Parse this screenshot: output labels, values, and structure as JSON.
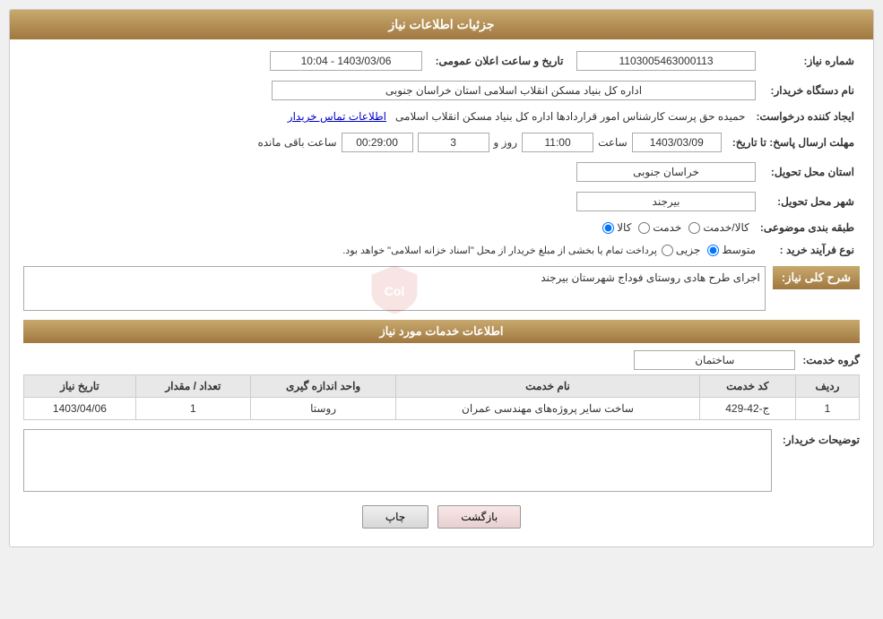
{
  "header": {
    "title": "جزئیات اطلاعات نیاز"
  },
  "fields": {
    "need_number_label": "شماره نیاز:",
    "need_number_value": "1103005463000113",
    "announce_label": "تاریخ و ساعت اعلان عمومی:",
    "announce_value": "1403/03/06 - 10:04",
    "buyer_name_label": "نام دستگاه خریدار:",
    "buyer_name_value": "اداره کل بنیاد مسکن انقلاب اسلامی استان خراسان جنوبی",
    "creator_label": "ایجاد کننده درخواست:",
    "creator_value": "حمیده حق پرست کارشناس امور قراردادها اداره کل بنیاد مسکن انقلاب اسلامی",
    "creator_link": "اطلاعات تماس خریدار",
    "deadline_label": "مهلت ارسال پاسخ: تا تاریخ:",
    "deadline_date": "1403/03/09",
    "deadline_time_label": "ساعت",
    "deadline_time": "11:00",
    "deadline_days_label": "روز و",
    "deadline_days": "3",
    "deadline_remaining_label": "ساعت باقی مانده",
    "deadline_remaining": "00:29:00",
    "province_label": "استان محل تحویل:",
    "province_value": "خراسان جنوبی",
    "city_label": "شهر محل تحویل:",
    "city_value": "بیرجند",
    "category_label": "طبقه بندی موضوعی:",
    "category_options": [
      "کالا",
      "خدمت",
      "کالا/خدمت"
    ],
    "category_selected": "کالا",
    "process_label": "نوع فرآیند خرید :",
    "process_options": [
      "جزیی",
      "متوسط"
    ],
    "process_selected": "متوسط",
    "process_note": "پرداخت تمام یا بخشی از مبلغ خریدار از محل \"اسناد خزانه اسلامی\" خواهد بود.",
    "description_section_label": "شرح کلی نیاز:",
    "description_value": "اجرای طرح هادی روستای فوداج شهرستان بیرجند",
    "services_section_label": "اطلاعات خدمات مورد نیاز",
    "service_group_label": "گروه خدمت:",
    "service_group_value": "ساختمان",
    "services_table": {
      "columns": [
        "ردیف",
        "کد خدمت",
        "نام خدمت",
        "واحد اندازه گیری",
        "تعداد / مقدار",
        "تاریخ نیاز"
      ],
      "rows": [
        {
          "row": "1",
          "code": "ج-42-429",
          "name": "ساخت سایر پروژه‌های مهندسی عمران",
          "unit": "روستا",
          "quantity": "1",
          "date": "1403/04/06"
        }
      ]
    },
    "buyer_description_label": "توضیحات خریدار:",
    "buyer_description_value": ""
  },
  "buttons": {
    "print_label": "چاپ",
    "back_label": "بازگشت"
  }
}
